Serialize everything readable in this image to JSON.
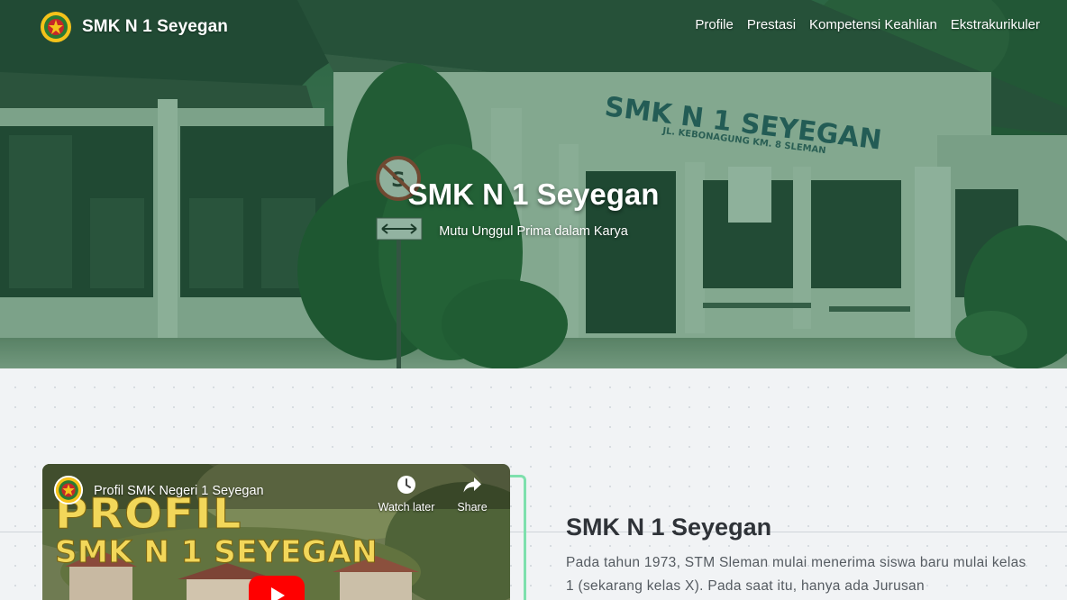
{
  "navbar": {
    "brand": "SMK N 1 Seyegan",
    "links": [
      "Profile",
      "Prestasi",
      "Kompetensi Keahlian",
      "Ekstrakurikuler"
    ]
  },
  "hero": {
    "title": "SMK N 1 Seyegan",
    "subtitle": "Mutu Unggul Prima dalam Karya",
    "building_sign": "SMK N 1 SEYEGAN",
    "building_sign_address": "JL. KEBONAGUNG KM. 8 SLEMAN"
  },
  "video": {
    "title": "Profil SMK Negeri 1 Seyegan",
    "thumbnail_line1": "PROFIL",
    "thumbnail_line2": "SMK N 1 SEYEGAN",
    "watch_later": "Watch later",
    "share": "Share"
  },
  "about": {
    "title": "SMK N 1 Seyegan",
    "text": "Pada tahun 1973, STM Sleman mulai menerima siswa baru mulai kelas 1 (sekarang kelas X). Pada saat itu, hanya ada Jurusan"
  },
  "icons": {
    "logo": "school-emblem-icon",
    "watch_later": "clock-icon",
    "share": "share-arrow-icon",
    "play": "youtube-play-icon"
  },
  "colors": {
    "hero_tint": "#145f37",
    "accent_green": "#7ee0ad",
    "youtube_red": "#ff0000",
    "thumbnail_text": "#f2d75a"
  }
}
